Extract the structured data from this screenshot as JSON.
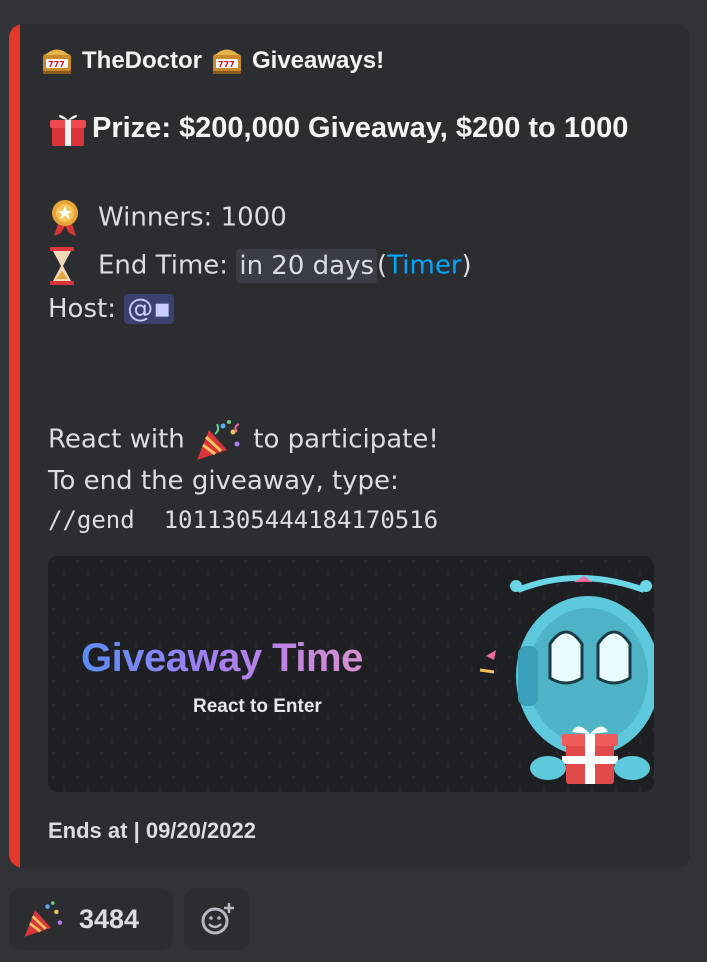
{
  "embed": {
    "accent_color": "#e3382b",
    "author": {
      "icon": "slot-machine-icon",
      "name": "TheDoctor",
      "suffix": "Giveaways!"
    },
    "prize_label": "Prize: $200,000 Giveaway, $200 to 1000",
    "winners_label": "Winners: 1000",
    "end_time_label": "End Time:",
    "end_time_value": "in 20 days",
    "timer_open": "(",
    "timer_link": "Timer",
    "timer_close": ")",
    "host_label": "Host:",
    "host_mention": "@▪",
    "react_prefix": "React with",
    "react_suffix": "to participate!",
    "end_instructions": "To end the giveaway, type:",
    "end_command": "//gend  1011305444184170516",
    "banner": {
      "title": "Giveaway Time",
      "subtitle": "React to Enter"
    },
    "footer": "Ends at | 09/20/2022"
  },
  "reactions": [
    {
      "icon": "party-popper-icon",
      "count": "3484"
    }
  ],
  "add_reaction_icon": "add-reaction-icon"
}
